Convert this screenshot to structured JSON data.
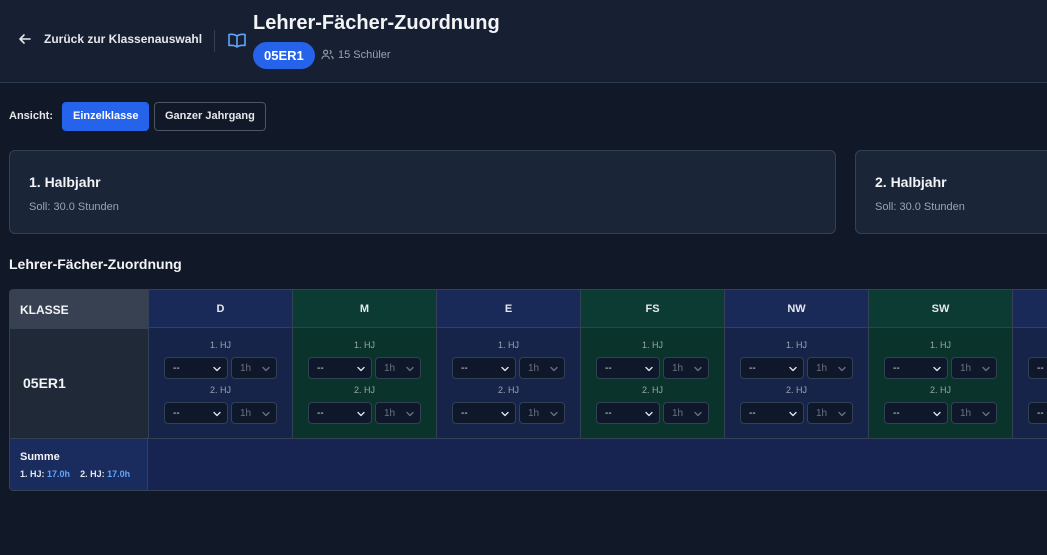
{
  "header": {
    "back_label": "Zurück zur Klassenauswahl",
    "title": "Lehrer-Fächer-Zuordnung",
    "class_badge": "05ER1",
    "students": "15 Schüler"
  },
  "view": {
    "label": "Ansicht:",
    "options": [
      "Einzelklasse",
      "Ganzer Jahrgang"
    ],
    "selected": "Einzelklasse"
  },
  "halbjahre": [
    {
      "title": "1. Halbjahr",
      "soll": "Soll: 30.0 Stunden"
    },
    {
      "title": "2. Halbjahr",
      "soll": "Soll: 30.0 Stunden"
    }
  ],
  "section_title": "Lehrer-Fächer-Zuordnung",
  "grid": {
    "klasse_header": "KLASSE",
    "klasse": "05ER1",
    "hj1_label": "1. HJ",
    "hj2_label": "2. HJ",
    "teacher_placeholder": "--",
    "hours_placeholder": "1h",
    "subjects": [
      {
        "name": "D",
        "color": "#1a2a58"
      },
      {
        "name": "M",
        "color": "#0b3b33"
      },
      {
        "name": "E",
        "color": "#1a2a58"
      },
      {
        "name": "FS",
        "color": "#0b3b33"
      },
      {
        "name": "NW",
        "color": "#1a2a58"
      },
      {
        "name": "SW",
        "color": "#0b3b33"
      },
      {
        "name": "",
        "color": "#1a2a58"
      }
    ],
    "summe": {
      "title": "Summe",
      "hj1_label": "1. HJ:",
      "hj1_value": "17.0h",
      "hj2_label": "2. HJ:",
      "hj2_value": "17.0h"
    }
  },
  "colors": {
    "accent": "#2563eb",
    "background": "#111827",
    "highlight": "#60a5fa"
  }
}
